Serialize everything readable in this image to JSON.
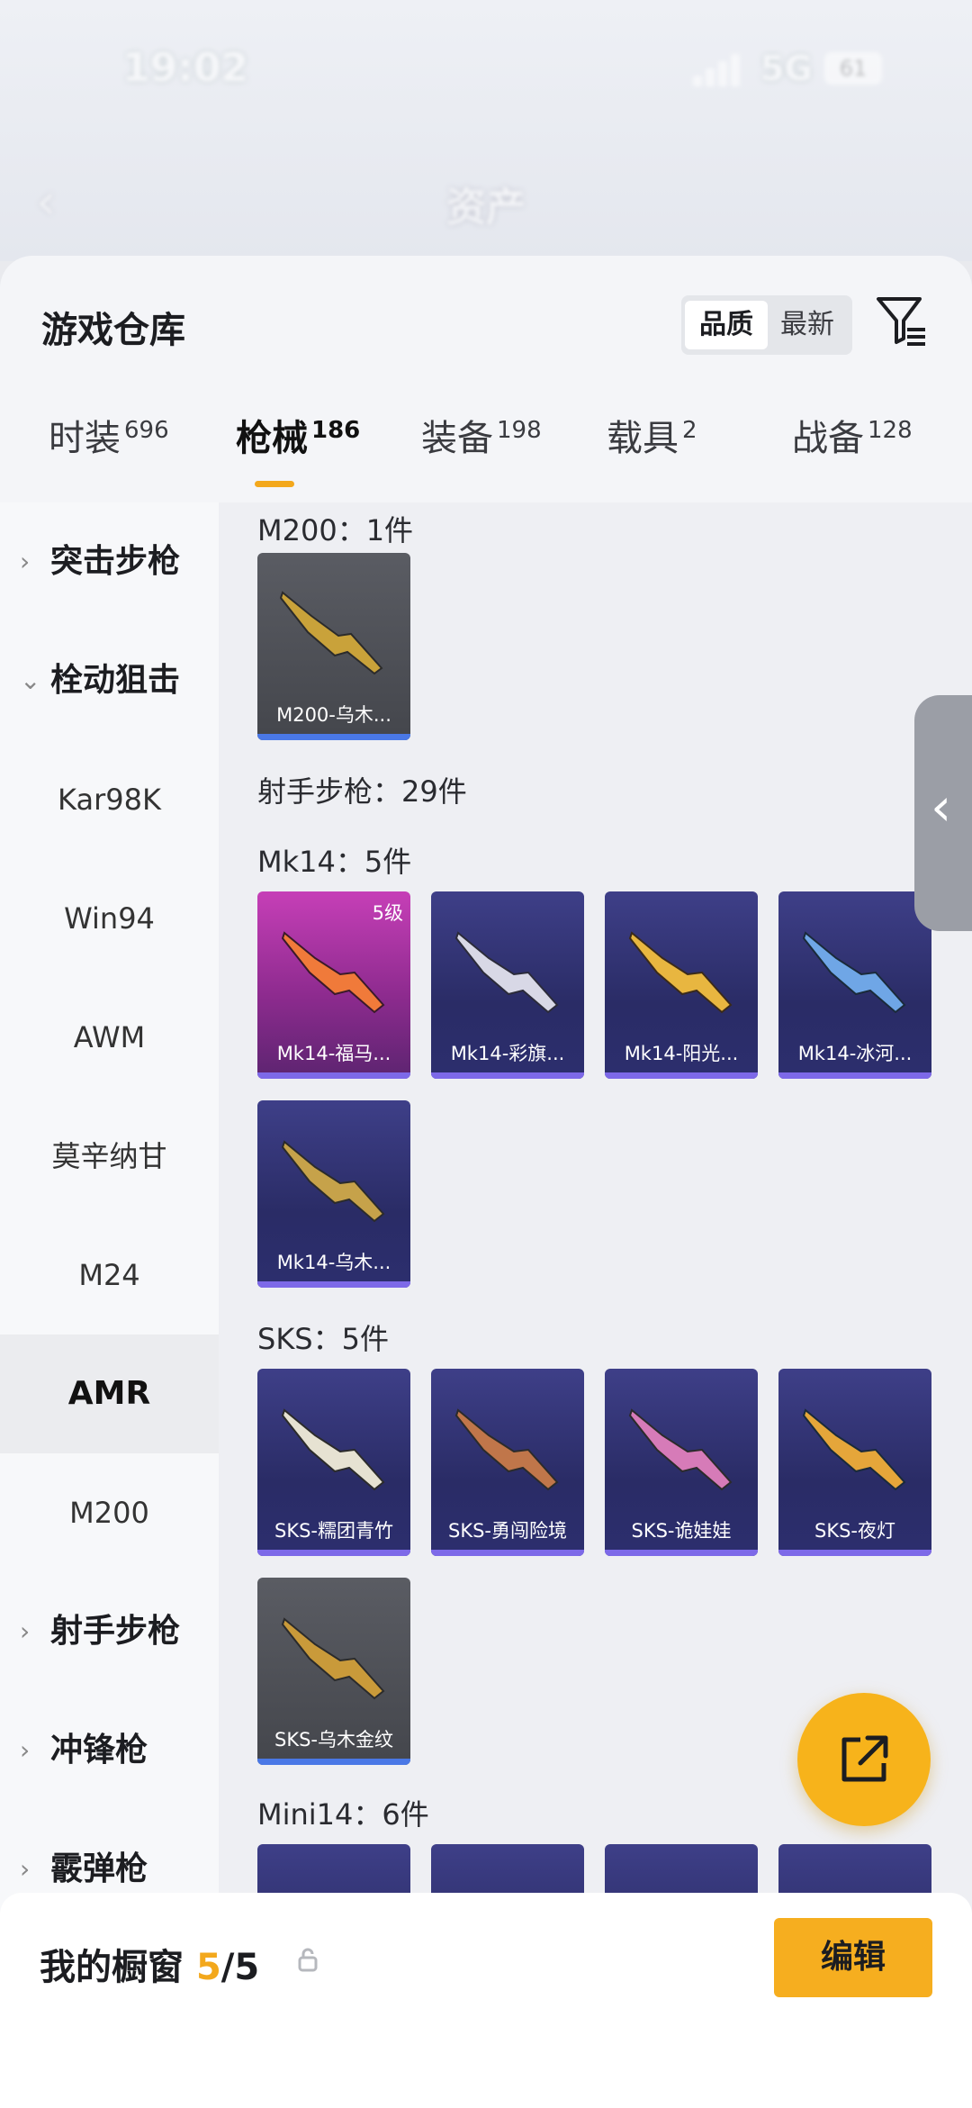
{
  "status": {
    "time": "19:02",
    "network": "5G",
    "battery": "61"
  },
  "nav": {
    "title": "资产"
  },
  "header": {
    "title": "游戏仓库",
    "sort_options": [
      "品质",
      "最新"
    ],
    "active_sort": "品质"
  },
  "tabs": [
    {
      "label": "时装",
      "count": "696"
    },
    {
      "label": "枪械",
      "count": "186"
    },
    {
      "label": "装备",
      "count": "198"
    },
    {
      "label": "载具",
      "count": "2"
    },
    {
      "label": "战备",
      "count": "128"
    }
  ],
  "active_tab": "枪械",
  "sidebar": {
    "items": [
      {
        "label": "突击步枪",
        "type": "group",
        "expanded": false
      },
      {
        "label": "栓动狙击",
        "type": "group",
        "expanded": true
      },
      {
        "label": "Kar98K",
        "type": "sub"
      },
      {
        "label": "Win94",
        "type": "sub"
      },
      {
        "label": "AWM",
        "type": "sub"
      },
      {
        "label": "莫辛纳甘",
        "type": "sub"
      },
      {
        "label": "M24",
        "type": "sub"
      },
      {
        "label": "AMR",
        "type": "sub",
        "selected": true
      },
      {
        "label": "M200",
        "type": "sub"
      },
      {
        "label": "射手步枪",
        "type": "group",
        "expanded": false
      },
      {
        "label": "冲锋枪",
        "type": "group",
        "expanded": false
      },
      {
        "label": "霰弹枪",
        "type": "group",
        "expanded": false
      }
    ]
  },
  "content": {
    "m200_header": "M200：1件",
    "m200_items": [
      "M200-乌木..."
    ],
    "dmr_header": "射手步枪：29件",
    "mk14_header": "Mk14：5件",
    "mk14_items": [
      "Mk14-福马...",
      "Mk14-彩旗...",
      "Mk14-阳光...",
      "Mk14-冰河...",
      "Mk14-乌木..."
    ],
    "mk14_level": "5级",
    "sks_header": "SKS：5件",
    "sks_items": [
      "SKS-糯团青竹",
      "SKS-勇闯险境",
      "SKS-诡娃娃",
      "SKS-夜灯",
      "SKS-乌木金纹"
    ],
    "mini14_header": "Mini14：6件"
  },
  "bottom": {
    "label": "我的橱窗",
    "current": "5",
    "total": "/5",
    "edit_label": "编辑"
  },
  "colors": {
    "accent": "#f6ae1f",
    "rare_bar": "#7d69e8",
    "common_bar": "#4a78e6"
  }
}
